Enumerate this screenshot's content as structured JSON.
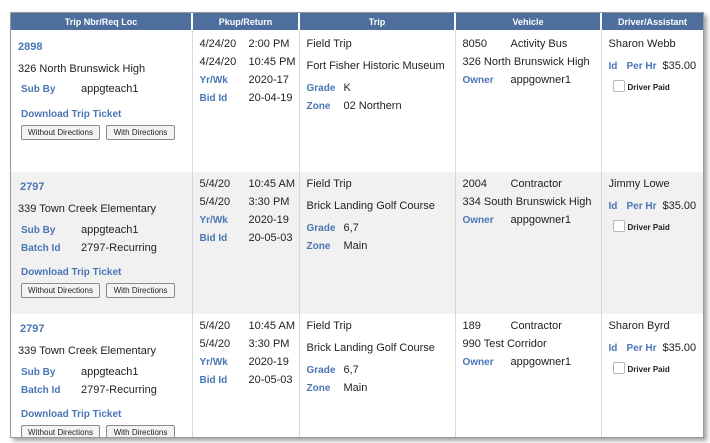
{
  "headers": [
    "Trip Nbr/Req Loc",
    "Pkup/Return",
    "Trip",
    "Vehicle",
    "Driver/Assistant"
  ],
  "labels": {
    "sub_by": "Sub By",
    "batch_id": "Batch Id",
    "download": "Download Trip Ticket",
    "without": "Without Directions",
    "with": "With Directions",
    "yrwk": "Yr/Wk",
    "bid_id": "Bid Id",
    "grade": "Grade",
    "zone": "Zone",
    "owner": "Owner",
    "id": "Id",
    "per_hr": "Per Hr",
    "driver_paid": "Driver Paid"
  },
  "rows": [
    {
      "trip_nbr": "2898",
      "req_loc": "326 North Brunswick High",
      "sub_by": "appgteach1",
      "batch_id": "",
      "pkup_date": "4/24/20",
      "pkup_time": "2:00 PM",
      "ret_date": "4/24/20",
      "ret_time": "10:45 PM",
      "yrwk": "2020-17",
      "bid_id": "20-04-19",
      "trip_type": "Field Trip",
      "destination": "Fort Fisher Historic Museum",
      "grade": "K",
      "zone": "02 Northern",
      "veh_num": "8050",
      "veh_type": "Activity Bus",
      "veh_loc": "326 North Brunswick High",
      "owner": "appgowner1",
      "driver": "Sharon Webb",
      "per_hr": "$35.00"
    },
    {
      "trip_nbr": "2797",
      "req_loc": "339 Town Creek Elementary",
      "sub_by": "appgteach1",
      "batch_id": "2797-Recurring",
      "pkup_date": "5/4/20",
      "pkup_time": "10:45 AM",
      "ret_date": "5/4/20",
      "ret_time": "3:30 PM",
      "yrwk": "2020-19",
      "bid_id": "20-05-03",
      "trip_type": "Field Trip",
      "destination": "Brick Landing Golf Course",
      "grade": "6,7",
      "zone": "Main",
      "veh_num": "2004",
      "veh_type": "Contractor",
      "veh_loc": "334 South Brunswick High",
      "owner": "appgowner1",
      "driver": "Jimmy Lowe",
      "per_hr": "$35.00"
    },
    {
      "trip_nbr": "2797",
      "req_loc": "339 Town Creek Elementary",
      "sub_by": "appgteach1",
      "batch_id": "2797-Recurring",
      "pkup_date": "5/4/20",
      "pkup_time": "10:45 AM",
      "ret_date": "5/4/20",
      "ret_time": "3:30 PM",
      "yrwk": "2020-19",
      "bid_id": "20-05-03",
      "trip_type": "Field Trip",
      "destination": "Brick Landing Golf Course",
      "grade": "6,7",
      "zone": "Main",
      "veh_num": "189",
      "veh_type": "Contractor",
      "veh_loc": "990 Test Corridor",
      "owner": "appgowner1",
      "driver": "Sharon Byrd",
      "per_hr": "$35.00"
    }
  ]
}
